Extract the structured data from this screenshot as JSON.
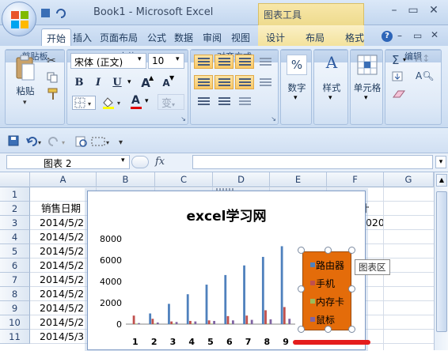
{
  "window": {
    "title": "Book1 - Microsoft Excel",
    "context_tab_group": "图表工具"
  },
  "tabs": [
    "开始",
    "插入",
    "页面布局",
    "公式",
    "数据",
    "审阅",
    "视图"
  ],
  "context_tabs": [
    "设计",
    "布局",
    "格式"
  ],
  "ribbon": {
    "clipboard": {
      "label": "剪贴板",
      "paste": "粘贴"
    },
    "font": {
      "label": "字体",
      "name": "宋体 (正文)",
      "size": "10",
      "bold": "B",
      "italic": "I",
      "underline": "U",
      "grow": "A",
      "shrink": "A",
      "color": "A",
      "phonetic": "变"
    },
    "alignment": {
      "label": "对齐方式"
    },
    "number": {
      "label": "数字",
      "icon_text": "%"
    },
    "styles": {
      "label": "样式",
      "icon_text": "A"
    },
    "cells": {
      "label": "单元格"
    },
    "editing": {
      "label": "编辑"
    }
  },
  "namebox": "图表 2",
  "fx_label": "fx",
  "columns": [
    "A",
    "B",
    "C",
    "D",
    "E",
    "F",
    "G"
  ],
  "rows": [
    "1",
    "2",
    "3",
    "4",
    "5",
    "6",
    "7",
    "8",
    "9",
    "10",
    "11"
  ],
  "cells": {
    "A2": "销售日期",
    "F2": "计",
    "F3": "2020",
    "A_dates": [
      "2014/5/2",
      "2014/5/2",
      "2014/5/2",
      "2014/5/2",
      "2014/5/2",
      "2014/5/2",
      "2014/5/2",
      "2014/5/2",
      "2014/5/3"
    ]
  },
  "tooltip": "图表区",
  "chart_data": {
    "type": "bar",
    "title": "excel学习网",
    "categories": [
      "1",
      "2",
      "3",
      "4",
      "5",
      "6",
      "7",
      "8",
      "9"
    ],
    "ylim": [
      0,
      8000
    ],
    "yticks": [
      "0",
      "2000",
      "4000",
      "6000",
      "8000"
    ],
    "series": [
      {
        "name": "路由器",
        "color": "#4f81bd",
        "values": [
          0,
          1000,
          1900,
          2800,
          3700,
          4600,
          5500,
          6300,
          7300
        ]
      },
      {
        "name": "手机",
        "color": "#c0504d",
        "values": [
          800,
          500,
          250,
          300,
          350,
          750,
          800,
          1300,
          1600
        ]
      },
      {
        "name": "内存卡",
        "color": "#9bbb59",
        "values": [
          50,
          50,
          50,
          50,
          50,
          50,
          50,
          50,
          50
        ]
      },
      {
        "name": "鼠标",
        "color": "#8064a2",
        "values": [
          100,
          150,
          200,
          250,
          300,
          350,
          400,
          450,
          500
        ]
      }
    ],
    "legend": "right",
    "grid": false
  }
}
